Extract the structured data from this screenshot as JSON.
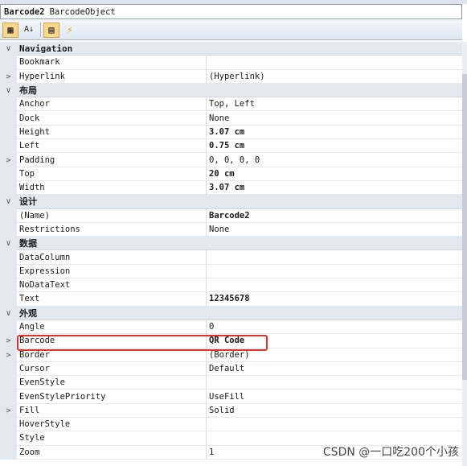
{
  "header": {
    "object_name": "Barcode2",
    "object_type": "BarcodeObject"
  },
  "toolbar": {
    "buttons": [
      "categorized-icon",
      "alphabetical-icon",
      "properties-icon",
      "events-icon"
    ]
  },
  "rows": [
    {
      "type": "cat",
      "label": "Navigation",
      "glyph": "∨"
    },
    {
      "type": "prop",
      "name": "Bookmark",
      "value": "",
      "glyph": ""
    },
    {
      "type": "prop",
      "name": "Hyperlink",
      "value": "(Hyperlink)",
      "glyph": ">"
    },
    {
      "type": "cat",
      "label": "布局",
      "glyph": "∨"
    },
    {
      "type": "prop",
      "name": "Anchor",
      "value": "Top, Left",
      "glyph": ""
    },
    {
      "type": "prop",
      "name": "Dock",
      "value": "None",
      "glyph": ""
    },
    {
      "type": "prop",
      "name": "Height",
      "value": "3.07 cm",
      "bold": true,
      "glyph": ""
    },
    {
      "type": "prop",
      "name": "Left",
      "value": "0.75 cm",
      "bold": true,
      "glyph": ""
    },
    {
      "type": "prop",
      "name": "Padding",
      "value": "0, 0, 0, 0",
      "glyph": ">"
    },
    {
      "type": "prop",
      "name": "Top",
      "value": "20 cm",
      "bold": true,
      "glyph": ""
    },
    {
      "type": "prop",
      "name": "Width",
      "value": "3.07 cm",
      "bold": true,
      "glyph": ""
    },
    {
      "type": "cat",
      "label": "设计",
      "glyph": "∨"
    },
    {
      "type": "prop",
      "name": "(Name)",
      "value": "Barcode2",
      "bold": true,
      "glyph": ""
    },
    {
      "type": "prop",
      "name": "Restrictions",
      "value": "None",
      "glyph": ""
    },
    {
      "type": "cat",
      "label": "数据",
      "glyph": "∨"
    },
    {
      "type": "prop",
      "name": "DataColumn",
      "value": "",
      "glyph": ""
    },
    {
      "type": "prop",
      "name": "Expression",
      "value": "",
      "glyph": ""
    },
    {
      "type": "prop",
      "name": "NoDataText",
      "value": "",
      "glyph": ""
    },
    {
      "type": "prop",
      "name": "Text",
      "value": "12345678",
      "bold": true,
      "glyph": ""
    },
    {
      "type": "cat",
      "label": "外观",
      "glyph": "∨"
    },
    {
      "type": "prop",
      "name": "Angle",
      "value": "0",
      "glyph": ""
    },
    {
      "type": "prop",
      "name": "Barcode",
      "value": "QR Code",
      "bold": true,
      "glyph": ">"
    },
    {
      "type": "prop",
      "name": "Border",
      "value": "(Border)",
      "glyph": ">"
    },
    {
      "type": "prop",
      "name": "Cursor",
      "value": "Default",
      "glyph": ""
    },
    {
      "type": "prop",
      "name": "EvenStyle",
      "value": "",
      "glyph": ""
    },
    {
      "type": "prop",
      "name": "EvenStylePriority",
      "value": "UseFill",
      "glyph": ""
    },
    {
      "type": "prop",
      "name": "Fill",
      "value": "Solid",
      "glyph": ">"
    },
    {
      "type": "prop",
      "name": "HoverStyle",
      "value": "",
      "glyph": ""
    },
    {
      "type": "prop",
      "name": "Style",
      "value": "",
      "glyph": ""
    },
    {
      "type": "prop",
      "name": "Zoom",
      "value": "1",
      "glyph": ""
    }
  ],
  "watermark": "CSDN @一口吃200个小孩"
}
